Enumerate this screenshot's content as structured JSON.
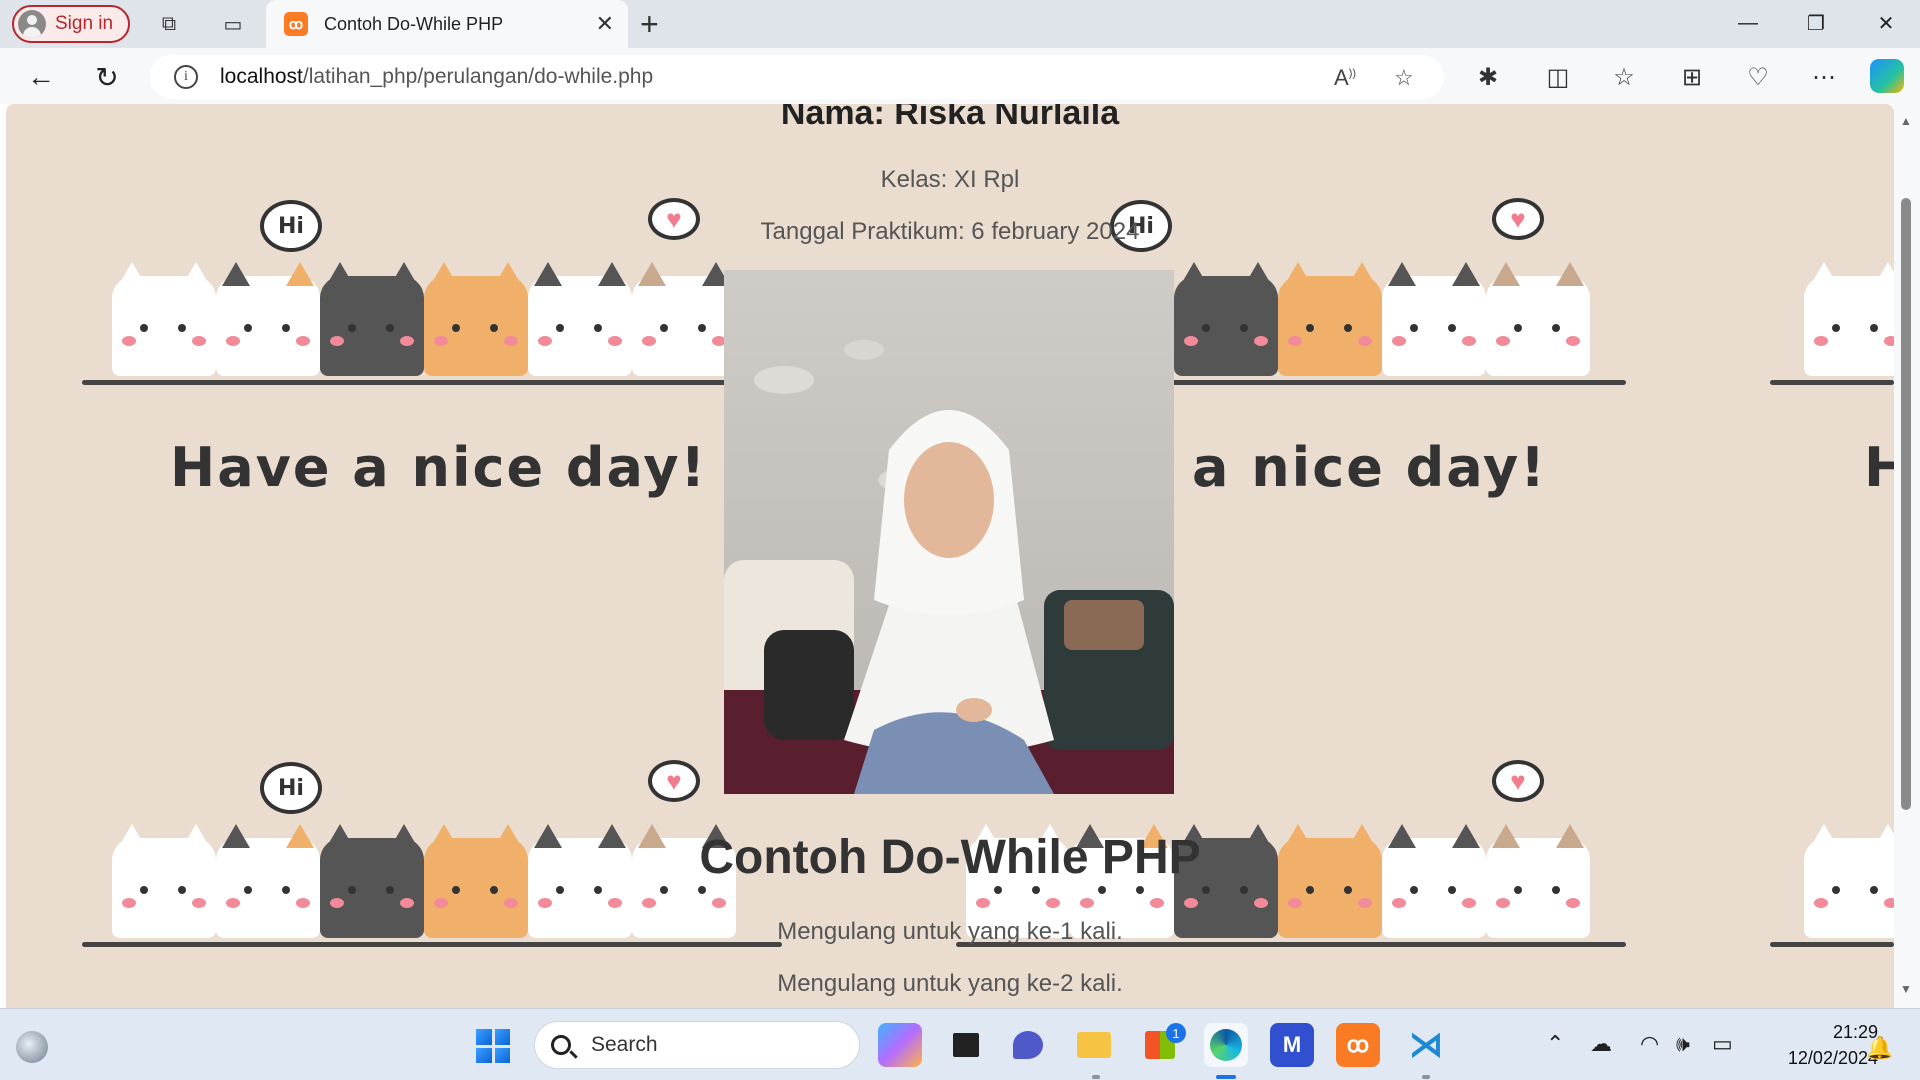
{
  "browser": {
    "signin_label": "Sign in",
    "tab_title": "Contoh Do-While PHP",
    "address": {
      "host": "localhost",
      "path": "/latihan_php/perulangan/do-while.php"
    }
  },
  "page": {
    "nama": "Nama: Riska Nurlaila",
    "kelas": "Kelas: XI Rpl",
    "tanggal": "Tanggal Praktikum: 6 february 2024",
    "heading": "Contoh Do-While PHP",
    "loop_lines": [
      "Mengulang untuk yang ke-1 kali.",
      "Mengulang untuk yang ke-2 kali."
    ],
    "background_text": "Have a nice day!",
    "bubble_text": "Hi"
  },
  "taskbar": {
    "search_placeholder": "Search",
    "store_badge": "1",
    "time": "21:29",
    "date": "12/02/2024"
  },
  "colors": {
    "page_bg": "#eaddd0",
    "accent_red": "#b3282d",
    "xampp_orange": "#fb7a24"
  }
}
